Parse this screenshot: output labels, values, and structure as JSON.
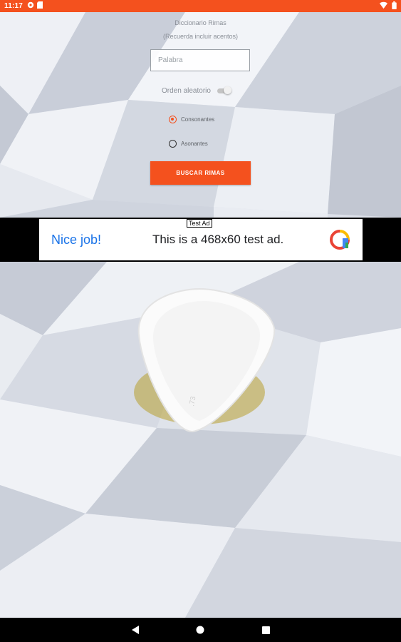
{
  "status_bar": {
    "time": "11:17",
    "icons_left": [
      "settings-badge-icon",
      "sd-card-icon"
    ],
    "icons_right": [
      "wifi-icon",
      "battery-icon"
    ]
  },
  "form": {
    "title": "Diccionario Rimas",
    "subtitle": "(Recuerda incluir acentos)",
    "word_input": {
      "value": "",
      "placeholder": "Palabra"
    },
    "random_order": {
      "label": "Orden aleatorio",
      "on": false
    },
    "radio_options": [
      {
        "label": "Consonantes",
        "checked": true
      },
      {
        "label": "Asonantes",
        "checked": false
      }
    ],
    "search_button": "BUSCAR RIMAS"
  },
  "ad": {
    "label": "Test Ad",
    "headline": "Nice job!",
    "body": "This is a 468x60 test ad."
  },
  "nav": {
    "icons": [
      "back-icon",
      "home-icon",
      "recents-icon"
    ]
  },
  "colors": {
    "accent": "#f4511e",
    "ad_link": "#1a73e8",
    "status_bar": "#f4511e"
  }
}
